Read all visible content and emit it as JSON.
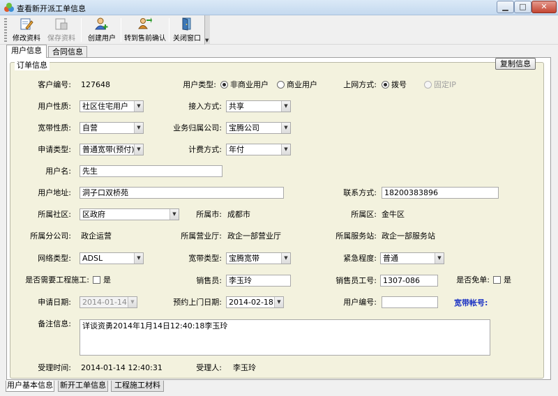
{
  "window": {
    "title": "查看新开派工单信息",
    "minimize_glyph": "▁",
    "maximize_glyph": "□",
    "close_glyph": "✕"
  },
  "toolbar": {
    "buttons": [
      {
        "label": "修改资料",
        "icon": "edit-document-icon",
        "enabled": true
      },
      {
        "label": "保存资料",
        "icon": "save-document-icon",
        "enabled": false
      },
      {
        "label": "创建用户",
        "icon": "add-user-icon",
        "enabled": true
      },
      {
        "label": "转到售前确认",
        "icon": "transfer-users-icon",
        "enabled": true
      },
      {
        "label": "关闭窗口",
        "icon": "exit-door-icon",
        "enabled": true
      }
    ],
    "overflow_glyph": "▼"
  },
  "tabs": [
    "用户信息",
    "合同信息"
  ],
  "group_title": "订单信息",
  "copy_button": "复制信息",
  "form": {
    "customer_no_label": "客户编号:",
    "customer_no": "127648",
    "user_type_label": "用户类型:",
    "user_type_options": [
      "非商业用户",
      "商业用户"
    ],
    "user_type_selected": "非商业用户",
    "access_method_label": "上网方式:",
    "access_method_options": [
      "拨号",
      "固定IP"
    ],
    "access_method_selected": "拨号",
    "user_nature_label": "用户性质:",
    "user_nature": "社区住宅用户",
    "join_method_label": "接入方式:",
    "join_method": "共享",
    "broadband_nature_label": "宽带性质:",
    "broadband_nature": "自营",
    "business_company_label": "业务归属公司:",
    "business_company": "宝腾公司",
    "apply_type_label": "申请类型:",
    "apply_type": "普通宽带(预付)",
    "billing_method_label": "计费方式:",
    "billing_method": "年付",
    "user_name_label": "用户名:",
    "user_name": "先生",
    "address_label": "用户地址:",
    "address": "洞子口双桥苑",
    "contact_label": "联系方式:",
    "contact": "18200383896",
    "community_label": "所属社区:",
    "community": "区政府",
    "city_label": "所属市:",
    "city": "成都市",
    "district_label": "所属区:",
    "district": "金牛区",
    "branch_label": "所属分公司:",
    "branch": "政企运营",
    "hall_label": "所属营业厅:",
    "hall": "政企一部营业厅",
    "station_label": "所属服务站:",
    "station": "政企一部服务站",
    "network_type_label": "网络类型:",
    "network_type": "ADSL",
    "broadband_type_label": "宽带类型:",
    "broadband_type": "宝腾宽带",
    "urgency_label": "紧急程度:",
    "urgency": "普通",
    "need_construction_label": "是否需要工程施工:",
    "need_construction_option": "是",
    "salesman_label": "销售员:",
    "salesman": "李玉玲",
    "salesman_id_label": "销售员工号:",
    "salesman_id": "1307-086",
    "free_order_label": "是否免单:",
    "free_order_option": "是",
    "apply_date_label": "申请日期:",
    "apply_date": "2014-01-14",
    "visit_date_label": "预约上门日期:",
    "visit_date": "2014-02-18",
    "user_no_label": "用户编号:",
    "user_no": "",
    "broadband_account_label": "宽带帐号:",
    "memo_label": "备注信息:",
    "memo": "详谈资勇2014年1月14日12:40:18李玉玲",
    "accept_time_label": "受理时间:",
    "accept_time": "2014-01-14 12:40:31",
    "acceptor_label": "受理人:",
    "acceptor": "李玉玲"
  },
  "bottom_tabs": [
    "用户基本信息",
    "新开工单信息",
    "工程施工材料"
  ],
  "colors": {
    "group_bg": "#f3f2de",
    "account_label": "#1c33c4",
    "close_button": "#c44632"
  }
}
